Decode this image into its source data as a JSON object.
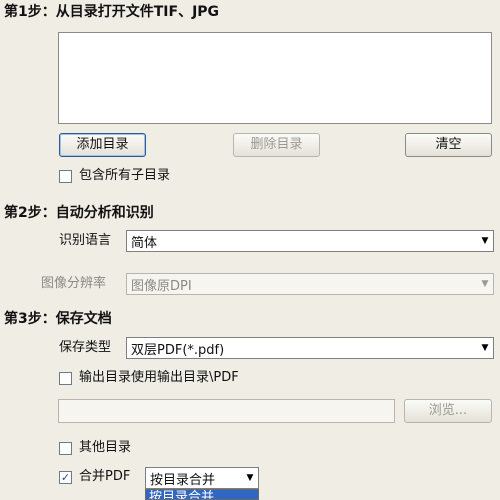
{
  "step1": {
    "title": "第1步：从目录打开文件TIF、JPG",
    "add_dir_label": "添加目录",
    "delete_dir_label": "删除目录",
    "clear_label": "清空",
    "include_subdirs_label": "包含所有子目录"
  },
  "step2": {
    "title": "第2步：自动分析和识别",
    "language_label": "识别语言",
    "language_value": "简体",
    "resolution_label": "图像分辨率",
    "resolution_value": "图像原DPI"
  },
  "step3": {
    "title": "第3步：保存文档",
    "save_type_label": "保存类型",
    "save_type_value": "双层PDF(*.pdf)",
    "output_dir_label": "输出目录使用输出目录\\PDF",
    "output_path_value": "",
    "browse_label": "浏览...",
    "other_dir_label": "其他目录",
    "merge_pdf_label": "合并PDF",
    "merge_mode_value": "按目录合并",
    "merge_mode_option": "按目录合并"
  },
  "icons": {
    "checkmark": "✓",
    "dropdown_arrow": "▼"
  }
}
